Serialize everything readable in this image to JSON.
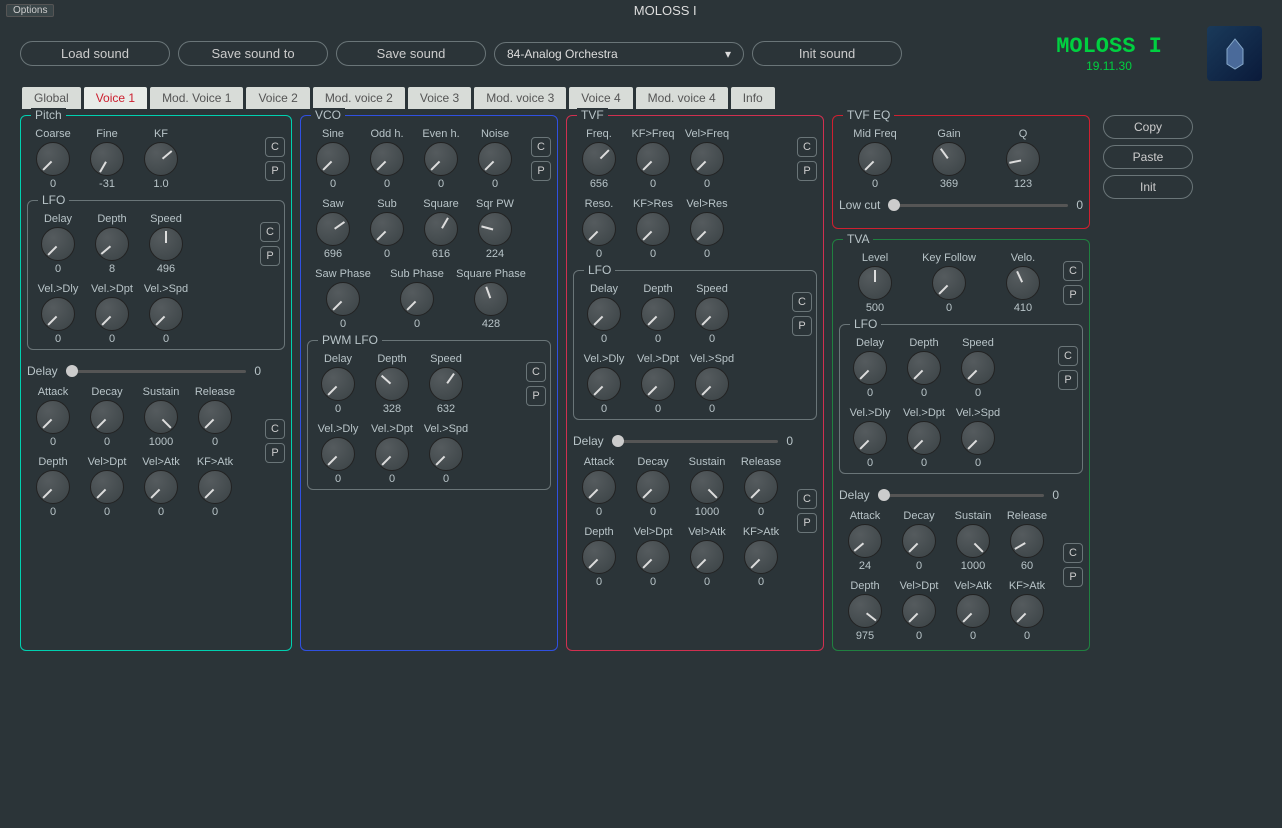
{
  "window": {
    "options": "Options",
    "title": "MOLOSS I"
  },
  "toolbar": {
    "load": "Load sound",
    "saveto": "Save sound to",
    "save": "Save sound",
    "preset": "84-Analog Orchestra",
    "init": "Init sound"
  },
  "brand": {
    "title": "MOLOSS I",
    "version": "19.11.30"
  },
  "tabs": [
    "Global",
    "Voice 1",
    "Mod. Voice 1",
    "Voice 2",
    "Mod. voice 2",
    "Voice 3",
    "Mod. voice 3",
    "Voice 4",
    "Mod. voice 4",
    "Info"
  ],
  "active_tab": 1,
  "side": {
    "copy": "Copy",
    "paste": "Paste",
    "init": "Init"
  },
  "cp": {
    "c": "C",
    "p": "P"
  },
  "pitch": {
    "title": "Pitch",
    "row1": [
      {
        "l": "Coarse",
        "v": "0",
        "a": -135
      },
      {
        "l": "Fine",
        "v": "-31",
        "a": -150
      },
      {
        "l": "KF",
        "v": "1.0",
        "a": 50
      }
    ],
    "lfo": {
      "title": "LFO",
      "r1": [
        {
          "l": "Delay",
          "v": "0",
          "a": -135
        },
        {
          "l": "Depth",
          "v": "8",
          "a": -130
        },
        {
          "l": "Speed",
          "v": "496",
          "a": 0
        }
      ],
      "r2": [
        {
          "l": "Vel.>Dly",
          "v": "0",
          "a": -135
        },
        {
          "l": "Vel.>Dpt",
          "v": "0",
          "a": -135
        },
        {
          "l": "Vel.>Spd",
          "v": "0",
          "a": -135
        }
      ]
    },
    "delay": {
      "label": "Delay",
      "value": "0"
    },
    "adsr": [
      {
        "l": "Attack",
        "v": "0",
        "a": -135
      },
      {
        "l": "Decay",
        "v": "0",
        "a": -135
      },
      {
        "l": "Sustain",
        "v": "1000",
        "a": 135
      },
      {
        "l": "Release",
        "v": "0",
        "a": -135
      }
    ],
    "mod": [
      {
        "l": "Depth",
        "v": "0",
        "a": -135
      },
      {
        "l": "Vel>Dpt",
        "v": "0",
        "a": -135
      },
      {
        "l": "Vel>Atk",
        "v": "0",
        "a": -135
      },
      {
        "l": "KF>Atk",
        "v": "0",
        "a": -135
      }
    ]
  },
  "vco": {
    "title": "VCO",
    "r1": [
      {
        "l": "Sine",
        "v": "0",
        "a": -135
      },
      {
        "l": "Odd h.",
        "v": "0",
        "a": -135
      },
      {
        "l": "Even h.",
        "v": "0",
        "a": -135
      },
      {
        "l": "Noise",
        "v": "0",
        "a": -135
      }
    ],
    "r2": [
      {
        "l": "Saw",
        "v": "696",
        "a": 55
      },
      {
        "l": "Sub",
        "v": "0",
        "a": -135
      },
      {
        "l": "Square",
        "v": "616",
        "a": 30
      },
      {
        "l": "Sqr PW",
        "v": "224",
        "a": -75
      }
    ],
    "r3": [
      {
        "l": "Saw Phase",
        "v": "0",
        "a": -135
      },
      {
        "l": "Sub Phase",
        "v": "0",
        "a": -135
      },
      {
        "l": "Square Phase",
        "v": "428",
        "a": -20
      }
    ],
    "pwmlfo": {
      "title": "PWM LFO",
      "r1": [
        {
          "l": "Delay",
          "v": "0",
          "a": -135
        },
        {
          "l": "Depth",
          "v": "328",
          "a": -48
        },
        {
          "l": "Speed",
          "v": "632",
          "a": 35
        }
      ],
      "r2": [
        {
          "l": "Vel.>Dly",
          "v": "0",
          "a": -135
        },
        {
          "l": "Vel.>Dpt",
          "v": "0",
          "a": -135
        },
        {
          "l": "Vel.>Spd",
          "v": "0",
          "a": -135
        }
      ]
    }
  },
  "tvf": {
    "title": "TVF",
    "r1": [
      {
        "l": "Freq.",
        "v": "656",
        "a": 45
      },
      {
        "l": "KF>Freq",
        "v": "0",
        "a": -135
      },
      {
        "l": "Vel>Freq",
        "v": "0",
        "a": -135
      }
    ],
    "r2": [
      {
        "l": "Reso.",
        "v": "0",
        "a": -135
      },
      {
        "l": "KF>Res",
        "v": "0",
        "a": -135
      },
      {
        "l": "Vel>Res",
        "v": "0",
        "a": -135
      }
    ],
    "lfo": {
      "title": "LFO",
      "r1": [
        {
          "l": "Delay",
          "v": "0",
          "a": -135
        },
        {
          "l": "Depth",
          "v": "0",
          "a": -135
        },
        {
          "l": "Speed",
          "v": "0",
          "a": -135
        }
      ],
      "r2": [
        {
          "l": "Vel.>Dly",
          "v": "0",
          "a": -135
        },
        {
          "l": "Vel.>Dpt",
          "v": "0",
          "a": -135
        },
        {
          "l": "Vel.>Spd",
          "v": "0",
          "a": -135
        }
      ]
    },
    "delay": {
      "label": "Delay",
      "value": "0"
    },
    "adsr": [
      {
        "l": "Attack",
        "v": "0",
        "a": -135
      },
      {
        "l": "Decay",
        "v": "0",
        "a": -135
      },
      {
        "l": "Sustain",
        "v": "1000",
        "a": 135
      },
      {
        "l": "Release",
        "v": "0",
        "a": -135
      }
    ],
    "mod": [
      {
        "l": "Depth",
        "v": "0",
        "a": -135
      },
      {
        "l": "Vel>Dpt",
        "v": "0",
        "a": -135
      },
      {
        "l": "Vel>Atk",
        "v": "0",
        "a": -135
      },
      {
        "l": "KF>Atk",
        "v": "0",
        "a": -135
      }
    ]
  },
  "tvfeq": {
    "title": "TVF EQ",
    "r1": [
      {
        "l": "Mid Freq",
        "v": "0",
        "a": -135
      },
      {
        "l": "Gain",
        "v": "369",
        "a": -36
      },
      {
        "l": "Q",
        "v": "123",
        "a": -102
      }
    ],
    "lowcut": {
      "label": "Low cut",
      "value": "0"
    }
  },
  "tva": {
    "title": "TVA",
    "r1": [
      {
        "l": "Level",
        "v": "500",
        "a": 0
      },
      {
        "l": "Key Follow",
        "v": "0",
        "a": -135
      },
      {
        "l": "Velo.",
        "v": "410",
        "a": -25
      }
    ],
    "lfo": {
      "title": "LFO",
      "r1": [
        {
          "l": "Delay",
          "v": "0",
          "a": -135
        },
        {
          "l": "Depth",
          "v": "0",
          "a": -135
        },
        {
          "l": "Speed",
          "v": "0",
          "a": -135
        }
      ],
      "r2": [
        {
          "l": "Vel.>Dly",
          "v": "0",
          "a": -135
        },
        {
          "l": "Vel.>Dpt",
          "v": "0",
          "a": -135
        },
        {
          "l": "Vel.>Spd",
          "v": "0",
          "a": -135
        }
      ]
    },
    "delay": {
      "label": "Delay",
      "value": "0"
    },
    "adsr": [
      {
        "l": "Attack",
        "v": "24",
        "a": -130
      },
      {
        "l": "Decay",
        "v": "0",
        "a": -135
      },
      {
        "l": "Sustain",
        "v": "1000",
        "a": 135
      },
      {
        "l": "Release",
        "v": "60",
        "a": -120
      }
    ],
    "mod": [
      {
        "l": "Depth",
        "v": "975",
        "a": 128
      },
      {
        "l": "Vel>Dpt",
        "v": "0",
        "a": -135
      },
      {
        "l": "Vel>Atk",
        "v": "0",
        "a": -135
      },
      {
        "l": "KF>Atk",
        "v": "0",
        "a": -135
      }
    ]
  }
}
